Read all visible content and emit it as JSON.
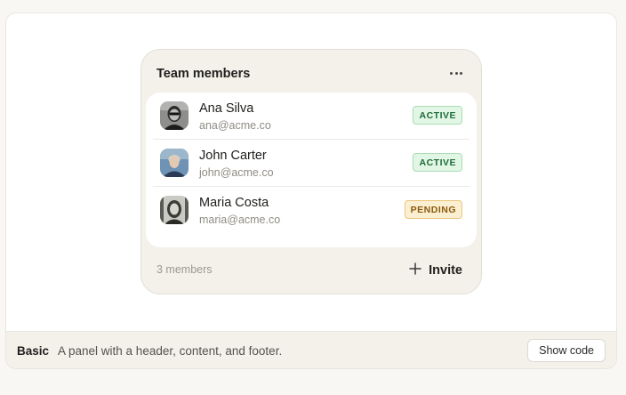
{
  "panel": {
    "title": "Team members",
    "menu_icon": "ellipsis-horizontal-icon",
    "members": [
      {
        "name": "Ana Silva",
        "email": "ana@acme.co",
        "status": "ACTIVE"
      },
      {
        "name": "John Carter",
        "email": "john@acme.co",
        "status": "ACTIVE"
      },
      {
        "name": "Maria Costa",
        "email": "maria@acme.co",
        "status": "PENDING"
      }
    ],
    "footer": {
      "count_text": "3 members",
      "invite_label": "Invite",
      "invite_icon": "plus-icon"
    }
  },
  "demo": {
    "title": "Basic",
    "description": "A panel with a header, content, and footer.",
    "show_code_label": "Show code"
  },
  "colors": {
    "active_bg": "#e2f6e6",
    "active_text": "#1e6b38",
    "pending_bg": "#fbefd2",
    "pending_text": "#8a5a0c",
    "panel_bg": "#f3f1ea"
  }
}
